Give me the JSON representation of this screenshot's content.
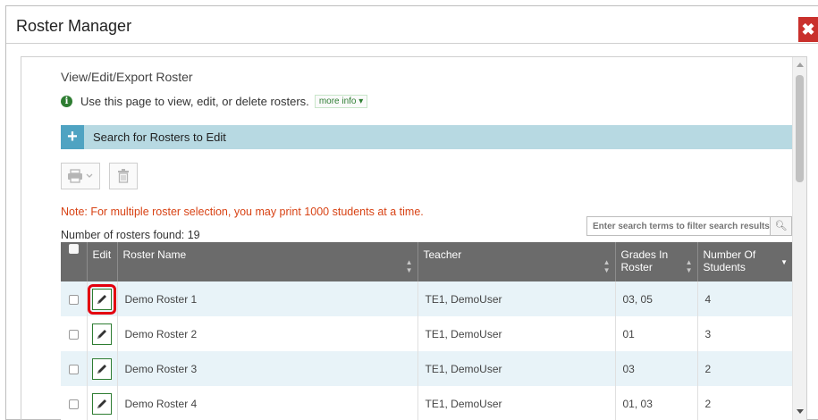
{
  "dialog": {
    "title": "Roster Manager",
    "close_icon": "close-icon"
  },
  "page": {
    "title": "View/Edit/Export Roster",
    "info_text": "Use this page to view, edit, or delete rosters.",
    "more_info_label": "more info ▾",
    "search_section_label": "Search for Rosters to Edit",
    "note": "Note: For multiple roster selection, you may print 1000 students at a time.",
    "count_text": "Number of rosters found: 19",
    "filter_placeholder": "Enter search terms to filter search results"
  },
  "toolbar": {
    "print_icon": "print-icon",
    "delete_icon": "trash-icon"
  },
  "table": {
    "columns": [
      "Edit",
      "Roster Name",
      "Teacher",
      "Grades In Roster",
      "Number Of Students"
    ],
    "rows": [
      {
        "name": "Demo Roster 1",
        "teacher": "TE1, DemoUser",
        "grades": "03, 05",
        "students": "4"
      },
      {
        "name": "Demo Roster 2",
        "teacher": "TE1, DemoUser",
        "grades": "01",
        "students": "3"
      },
      {
        "name": "Demo Roster 3",
        "teacher": "TE1, DemoUser",
        "grades": "03",
        "students": "2"
      },
      {
        "name": "Demo Roster 4",
        "teacher": "TE1, DemoUser",
        "grades": "01, 03",
        "students": "2"
      }
    ]
  },
  "colors": {
    "close": "#c9302c",
    "search_bar": "#b7d9e2",
    "header": "#6b6b6b",
    "note": "#d84315",
    "highlight": "#e3000f",
    "edit_border": "#2e7d32"
  }
}
